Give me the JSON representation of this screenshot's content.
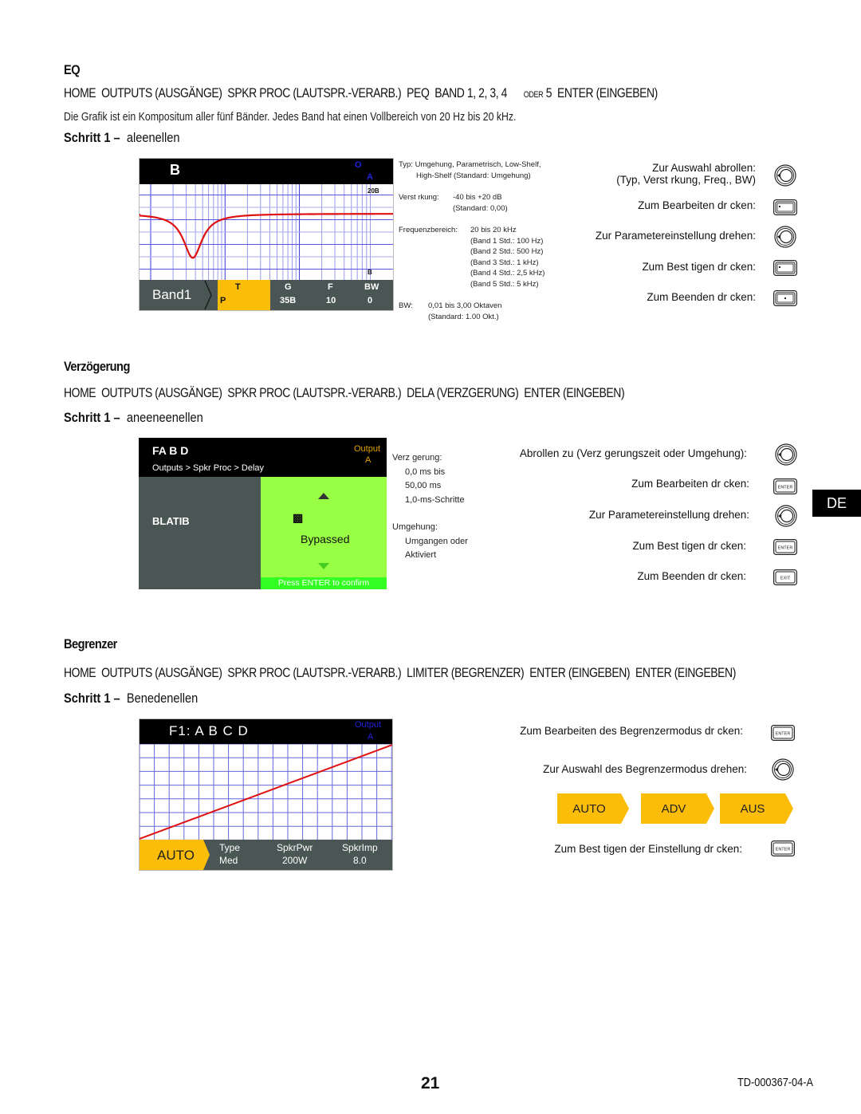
{
  "eq": {
    "heading": "EQ",
    "path": {
      "home": "HOME",
      "outputs": "OUTPUTS (AUSGÄNGE)",
      "spkr_proc": "SPKR PROC (LAUTSPR.-VERARB.)",
      "peq": "PEQ",
      "bands": "BAND 1, 2, 3, 4",
      "oder": "ODER",
      "band5": "5",
      "enter": "ENTER (EINGEBEN)"
    },
    "description": "Die Grafik ist ein Kompositum aller fünf Bänder. Jedes Band hat einen Vollbereich von 20 Hz bis 20 kHz.",
    "step_label": "Schritt 1 –",
    "step_text": "aleenellen",
    "screen": {
      "title": "B",
      "output_label": "O",
      "output_channel": "A",
      "scale_top": "20B",
      "scale_bottom": "B",
      "band_label": "Band1",
      "params": [
        {
          "name": "T",
          "value": "P",
          "active": true
        },
        {
          "name": "G",
          "value": "35B",
          "active": false
        },
        {
          "name": "F",
          "value": "10",
          "active": false
        },
        {
          "name": "BW",
          "value": "0",
          "active": false
        }
      ],
      "curve": {
        "type": "parametric notch",
        "notch_fraction_x": 0.21,
        "depth_fraction": 0.62
      }
    },
    "notes": {
      "typ_label": "Typ:",
      "typ_line1": "Umgehung, Parametrisch, Low-Shelf,",
      "typ_line2": "High-Shelf (Standard: Umgehung)",
      "gain_label": "Verst rkung:",
      "gain_range": "-40 bis +20 dB",
      "gain_default": "(Standard: 0,00)",
      "freq_label": "Frequenzbereich:",
      "freq_range": "20 bis 20 kHz",
      "freq_defaults": [
        "(Band 1 Std.: 100 Hz)",
        "(Band 2 Std.: 500 Hz)",
        "(Band 3 Std.: 1 kHz)",
        "(Band 4 Std.: 2,5 kHz)",
        "(Band 5 Std.: 5 kHz)"
      ],
      "bw_label": "BW:",
      "bw_range": "0,01 bis 3,00 Oktaven",
      "bw_default": "(Standard: 1.00 Okt.)"
    },
    "instructions": [
      {
        "text": "Zur Auswahl abrollen:",
        "text2": "(Typ, Verst rkung, Freq., BW)",
        "icon": "knob"
      },
      {
        "text": "Zum Bearbeiten dr cken:",
        "icon": "button"
      },
      {
        "text": "Zur Parametereinstellung drehen:",
        "icon": "knob"
      },
      {
        "text": "Zum Best tigen dr cken:",
        "icon": "button"
      },
      {
        "text": "Zum Beenden dr cken:",
        "icon": "button"
      }
    ]
  },
  "delay": {
    "heading": "Verzögerung",
    "path": {
      "home": "HOME",
      "outputs": "OUTPUTS (AUSGÄNGE)",
      "spkr_proc": "SPKR PROC (LAUTSPR.-VERARB.)",
      "dela": "DELA (VERZGERUNG)",
      "enter": "ENTER (EINGEBEN)"
    },
    "step_label": "Schritt 1 –",
    "step_text": "aneeneenellen",
    "screen": {
      "title": "FA B D",
      "breadcrumb": "Outputs > Spkr Proc > Delay",
      "output_label": "Output",
      "output_channel": "A",
      "left_label": "BLATIB",
      "value_glyph": "▩",
      "value_text": "Bypassed",
      "confirm_text": "Press ENTER to confirm"
    },
    "notes": {
      "delay_label": "Verz gerung:",
      "delay_lines": [
        "0,0 ms bis",
        "50,00 ms",
        "1,0-ms-Schritte"
      ],
      "bypass_label": "Umgehung:",
      "bypass_lines": [
        "Umgangen oder",
        "Aktiviert"
      ]
    },
    "instructions": [
      {
        "text": "Abrollen zu (Verz gerungszeit oder Umgehung):",
        "icon": "knob"
      },
      {
        "text": "Zum Bearbeiten dr cken:",
        "icon": "enter",
        "icon_text": "ENTER"
      },
      {
        "text": "Zur Parametereinstellung drehen:",
        "icon": "knob"
      },
      {
        "text": "Zum Best tigen dr cken:",
        "icon": "enter",
        "icon_text": "ENTER"
      },
      {
        "text": "Zum Beenden dr cken:",
        "icon": "exit",
        "icon_text": "EXIT"
      }
    ]
  },
  "limiter": {
    "heading": "Begrenzer",
    "path": {
      "home": "HOME",
      "outputs": "OUTPUTS (AUSGÄNGE)",
      "spkr_proc": "SPKR PROC (LAUTSPR.-VERARB.)",
      "limiter": "LIMITER (BEGRENZER)",
      "enter1": "ENTER (EINGEBEN)",
      "enter2": "ENTER (EINGEBEN)"
    },
    "step_label": "Schritt 1 –",
    "step_text": "Benedenellen",
    "screen": {
      "title": "F1: A B C D",
      "output_label": "Output",
      "output_channel": "A",
      "mode": "AUTO",
      "params": [
        {
          "name": "Type",
          "value": "Med"
        },
        {
          "name": "SpkrPwr",
          "value": "200W"
        },
        {
          "name": "SpkrImp",
          "value": "8.0"
        }
      ]
    },
    "instructions": [
      {
        "text": "Zum Bearbeiten des Begrenzermodus dr cken:",
        "icon": "enter",
        "icon_text": "ENTER"
      },
      {
        "text": "Zur Auswahl des Begrenzermodus drehen:",
        "icon": "knob"
      },
      {
        "text": "Zum Best tigen der Einstellung dr cken:",
        "icon": "enter",
        "icon_text": "ENTER"
      }
    ],
    "modes": [
      "AUTO",
      "ADV",
      "AUS"
    ]
  },
  "side_tab": "DE",
  "footer": {
    "page_number": "21",
    "doc_id": "TD-000367-04-A"
  },
  "colors": {
    "accent_yellow": "#fbbd08",
    "screen_green": "#99ff44",
    "confirm_green": "#33ff22",
    "footer_gray": "#4a5654",
    "curve_red": "#e01010",
    "grid_blue": "#5555dd",
    "output_blue": "#2222dd",
    "output_orange": "#e0a000"
  }
}
